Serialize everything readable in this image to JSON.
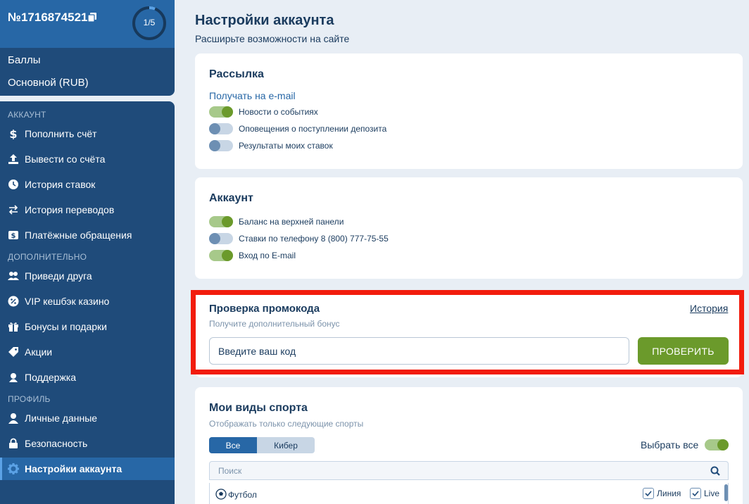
{
  "account": {
    "number": "№1716874521",
    "progress": "1/5",
    "progress_fraction": 0.2,
    "balances": [
      "Баллы",
      "Основной (RUB)"
    ]
  },
  "sidebar": {
    "sections": [
      {
        "title": "АККАУНТ",
        "items": [
          {
            "label": "Пополнить счёт",
            "icon": "dollar-icon"
          },
          {
            "label": "Вывести со счёта",
            "icon": "upload-icon"
          },
          {
            "label": "История ставок",
            "icon": "clock-icon"
          },
          {
            "label": "История переводов",
            "icon": "transfer-icon"
          },
          {
            "label": "Платёжные обращения",
            "icon": "payment-icon"
          }
        ]
      },
      {
        "title": "ДОПОЛНИТЕЛЬНО",
        "items": [
          {
            "label": "Приведи друга",
            "icon": "users-icon"
          },
          {
            "label": "VIP кешбэк казино",
            "icon": "percent-icon"
          },
          {
            "label": "Бонусы и подарки",
            "icon": "gift-icon"
          },
          {
            "label": "Акции",
            "icon": "tag-icon"
          },
          {
            "label": "Поддержка",
            "icon": "headset-icon"
          }
        ]
      },
      {
        "title": "ПРОФИЛЬ",
        "items": [
          {
            "label": "Личные данные",
            "icon": "user-icon"
          },
          {
            "label": "Безопасность",
            "icon": "lock-icon"
          },
          {
            "label": "Настройки аккаунта",
            "icon": "gear-icon",
            "active": true
          }
        ]
      }
    ]
  },
  "page": {
    "title": "Настройки аккаунта",
    "subtitle": "Расширьте возможности на сайте"
  },
  "mailing": {
    "title": "Рассылка",
    "subhead": "Получать на e-mail",
    "toggles": [
      {
        "label": "Новости о событиях",
        "on": true
      },
      {
        "label": "Оповещения о поступлении депозита",
        "on": false
      },
      {
        "label": "Результаты моих ставок",
        "on": false
      }
    ]
  },
  "account_settings": {
    "title": "Аккаунт",
    "toggles": [
      {
        "label": "Баланс на верхней панели",
        "on": true
      },
      {
        "label": "Ставки по телефону 8 (800) 777-75-55",
        "on": false
      },
      {
        "label": "Вход по E-mail",
        "on": true
      }
    ]
  },
  "promo": {
    "title": "Проверка промокода",
    "hint": "Получите дополнительный бонус",
    "history_link": "История",
    "placeholder": "Введите ваш код",
    "button": "ПРОВЕРИТЬ"
  },
  "sports": {
    "title": "Мои виды спорта",
    "hint": "Отображать только следующие спорты",
    "tabs": [
      "Все",
      "Кибер"
    ],
    "select_all": "Выбрать все",
    "select_all_on": true,
    "search_placeholder": "Поиск",
    "rows": [
      {
        "name": "Футбол",
        "line_label": "Линия",
        "live_label": "Live",
        "line": true,
        "live": true
      }
    ]
  },
  "colors": {
    "sidebar": "#1f4b7a",
    "accent_blue": "#2767a6",
    "green": "#6b9a2b",
    "highlight": "#f21c0d"
  }
}
